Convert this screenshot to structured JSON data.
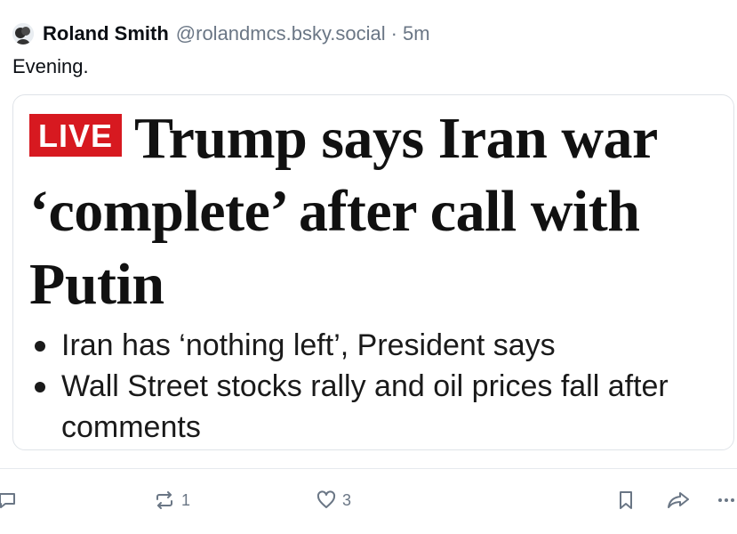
{
  "post": {
    "author_name": "Roland Smith",
    "author_handle": "@rolandmcs.bsky.social",
    "separator": "·",
    "timestamp": "5m",
    "text": "Evening."
  },
  "embed": {
    "badge": "LIVE",
    "headline": "Trump says Iran war ‘complete’ after call with Putin",
    "bullets": [
      "Iran has ‘nothing left’, President says",
      "Wall Street stocks rally and oil prices fall after comments"
    ]
  },
  "actions": {
    "reply": {
      "icon": "reply-icon",
      "count": ""
    },
    "repost": {
      "icon": "repost-icon",
      "count": "1"
    },
    "like": {
      "icon": "heart-icon",
      "count": "3"
    },
    "bookmark": {
      "icon": "bookmark-icon"
    },
    "share": {
      "icon": "share-icon"
    },
    "more": {
      "icon": "more-icon"
    }
  },
  "colors": {
    "live_badge": "#d71920",
    "muted_text": "#6a7685",
    "border": "#dfe3e8"
  }
}
